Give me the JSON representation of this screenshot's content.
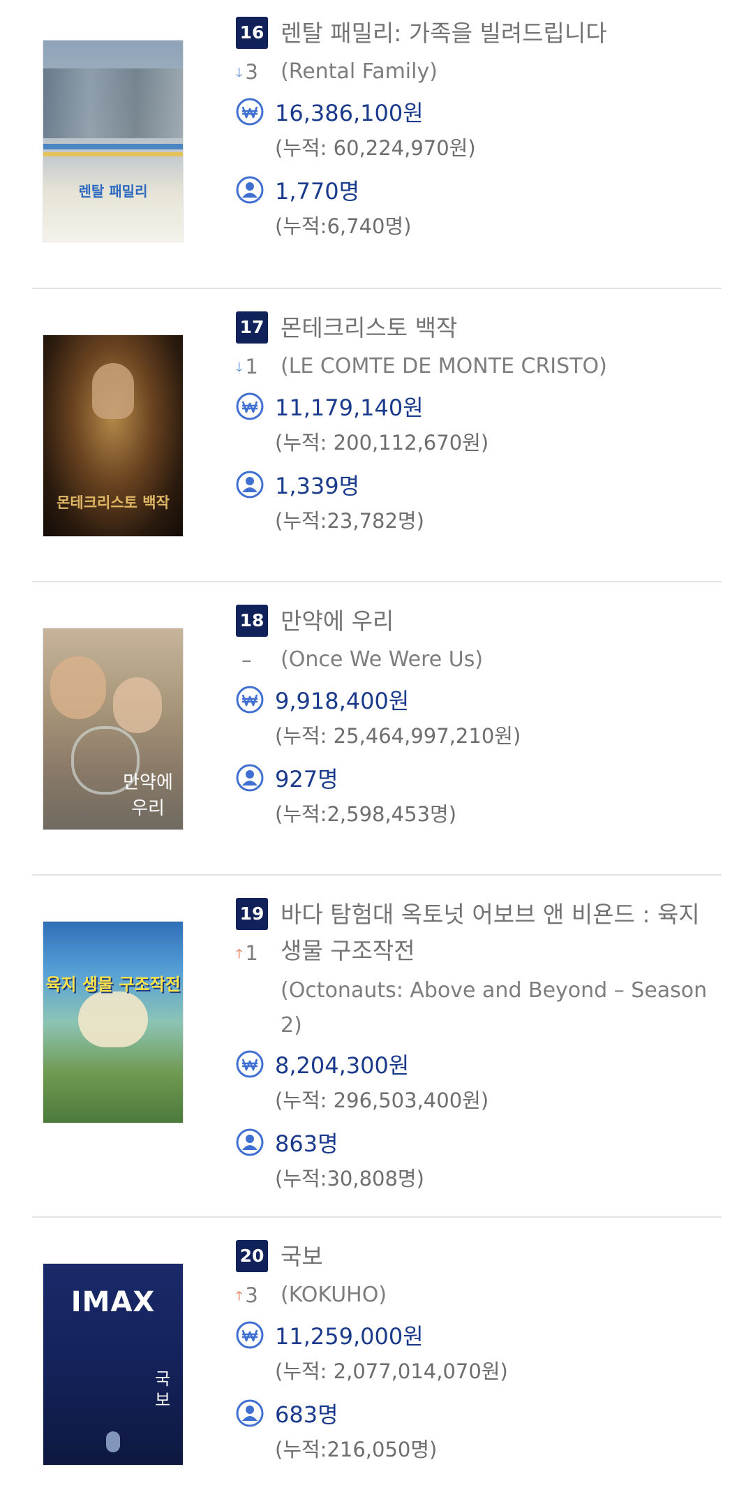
{
  "items": [
    {
      "rank": "16",
      "change_dir": "down",
      "change": "3",
      "title": "렌탈 패밀리: 가족을 빌려드립니다",
      "eng": "(Rental Family)",
      "revenue": "16,386,100원",
      "revenue_cum": "(누적: 60,224,970원)",
      "audience": "1,770명",
      "audience_cum": "(누적:6,740명)",
      "poster_text": "렌탈 패밀리"
    },
    {
      "rank": "17",
      "change_dir": "down",
      "change": "1",
      "title": "몬테크리스토 백작",
      "eng": "(LE COMTE DE MONTE CRISTO)",
      "revenue": "11,179,140원",
      "revenue_cum": "(누적: 200,112,670원)",
      "audience": "1,339명",
      "audience_cum": "(누적:23,782명)",
      "poster_text": "몬테크리스토 백작"
    },
    {
      "rank": "18",
      "change_dir": "none",
      "change": "–",
      "title": "만약에 우리",
      "eng": "(Once We Were Us)",
      "revenue": "9,918,400원",
      "revenue_cum": "(누적: 25,464,997,210원)",
      "audience": "927명",
      "audience_cum": "(누적:2,598,453명)",
      "poster_text": "만약에 우리"
    },
    {
      "rank": "19",
      "change_dir": "up",
      "change": "1",
      "title": "바다 탐험대 옥토넛 어보브 앤 비욘드 : 육지생물 구조작전",
      "eng": "(Octonauts: Above and Beyond – Season 2)",
      "revenue": "8,204,300원",
      "revenue_cum": "(누적: 296,503,400원)",
      "audience": "863명",
      "audience_cum": "(누적:30,808명)",
      "poster_text": "육지 생물 구조작전"
    },
    {
      "rank": "20",
      "change_dir": "up",
      "change": "3",
      "title": "국보",
      "eng": "(KOKUHO)",
      "revenue": "11,259,000원",
      "revenue_cum": "(누적: 2,077,014,070원)",
      "audience": "683명",
      "audience_cum": "(누적:216,050명)",
      "poster_text": "IMAX",
      "poster_sub": "국보"
    }
  ],
  "colors": {
    "rank_bg": "#11215a",
    "amount": "#1a3a8c",
    "icon": "#3f6fd1",
    "arrow_down": "#4a7ed6",
    "arrow_up": "#e8562f"
  },
  "icons": {
    "revenue": "won-icon",
    "audience": "user-icon"
  }
}
